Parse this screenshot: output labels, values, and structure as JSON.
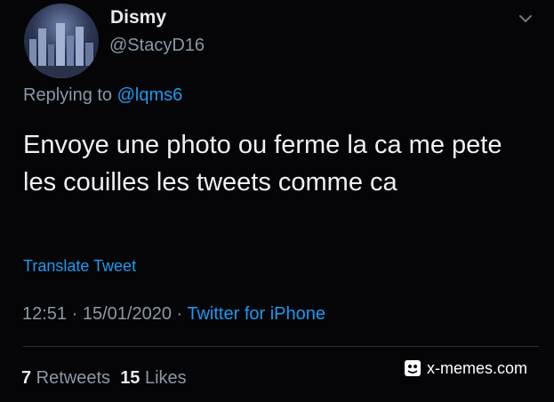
{
  "tweet": {
    "display_name": "Dismy",
    "handle": "@StacyD16",
    "reply_prefix": "Replying to ",
    "reply_mention": "@lqms6",
    "text": "Envoye une photo ou ferme la ca me pete les couilles les tweets comme ca",
    "translate_label": "Translate Tweet",
    "time": "12:51",
    "separator": " · ",
    "date": "15/01/2020",
    "source": "Twitter for iPhone",
    "retweets_count": "7",
    "retweets_label": " Retweets",
    "likes_count": "15",
    "likes_label": " Likes",
    "menu_icon": "chevron-down-icon",
    "avatar_icon": "avatar"
  },
  "watermark": {
    "text": "x-memes.com"
  },
  "colors": {
    "background": "#050508",
    "link": "#1d9bf0",
    "muted": "#8b98a5",
    "text": "#e7e9ea"
  }
}
